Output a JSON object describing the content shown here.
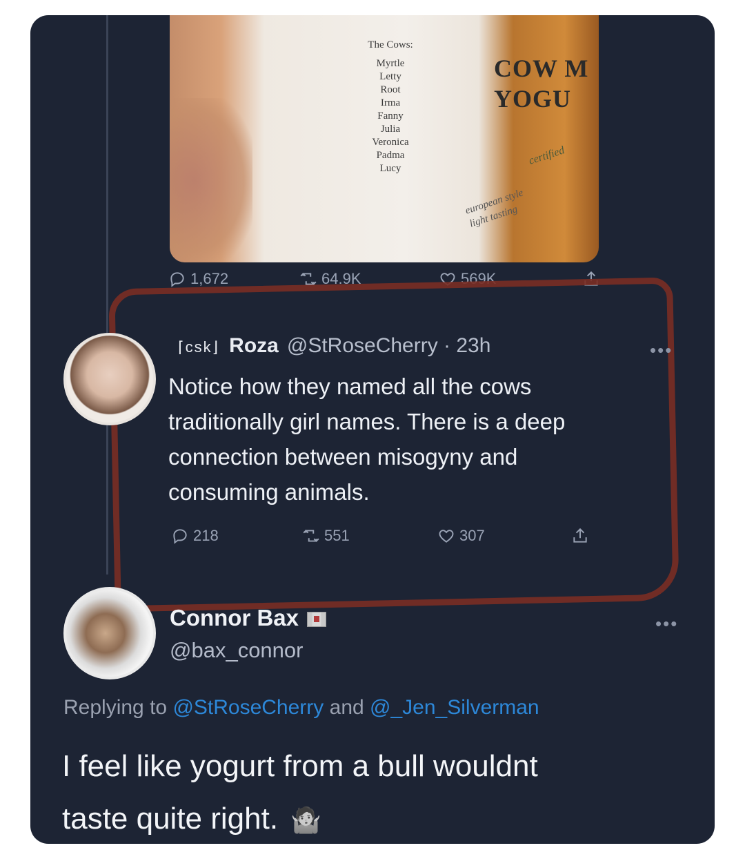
{
  "image": {
    "heading": "The Cows:",
    "cows": [
      "Myrtle",
      "Letty",
      "Root",
      "Irma",
      "Fanny",
      "Julia",
      "Veronica",
      "Padma",
      "Lucy"
    ],
    "brand_line1": "COW M",
    "brand_line2": "YOGU",
    "certified": "certified",
    "label_line1": "european style",
    "label_line2": "light tasting"
  },
  "top_stats": {
    "replies": "1,672",
    "retweets": "64.9K",
    "likes": "569K"
  },
  "roza_tweet": {
    "badge": "⌈csk⌋",
    "name": "Roza",
    "handle_time": "@StRoseCherry · 23h",
    "text_lines": [
      "Notice how they named all the cows",
      "traditionally girl names. There is a deep",
      "connection between misogyny and",
      "consuming animals."
    ],
    "replies": "218",
    "retweets": "551",
    "likes": "307",
    "more": "•••"
  },
  "connor_tweet": {
    "name": "Connor Bax",
    "handle": "@bax_connor",
    "more": "•••",
    "replying_prefix": "Replying to",
    "mention1": "@StRoseCherry",
    "and": "and",
    "mention2": "@_Jen_Silverman",
    "text_line1": "I feel like yogurt from a bull wouldnt",
    "text_line2": "taste quite right.",
    "emoji": "🤷"
  },
  "colors": {
    "background": "#1d2434",
    "mention": "#2d88d9",
    "highlight_circle": "#7a2e24"
  }
}
